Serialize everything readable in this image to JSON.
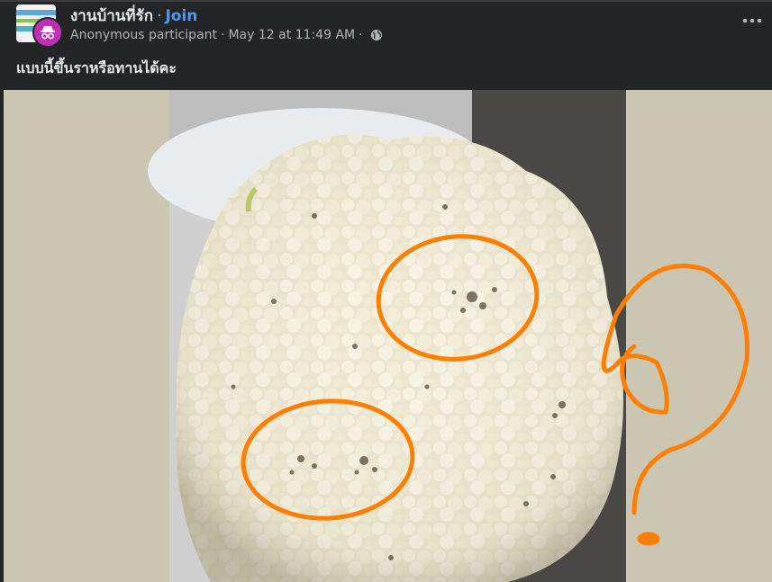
{
  "post": {
    "group_name": "งานบ้านที่รัก",
    "separator": "·",
    "join_label": "Join",
    "author": "Anonymous participant",
    "timestamp": "May 12 at 11:49 AM",
    "privacy_icon": "globe-icon",
    "more_icon": "more-options-icon",
    "text": "แบบนี้ขึ้นราหรือทานได้คะ"
  },
  "colors": {
    "background": "#242526",
    "text_primary": "#e4e6eb",
    "text_secondary": "#b0b3b8",
    "join_link": "#4599ff",
    "anon_avatar": "#c02fb6",
    "annotation": "#ff7f00",
    "media_background": "#cbc6b2"
  }
}
